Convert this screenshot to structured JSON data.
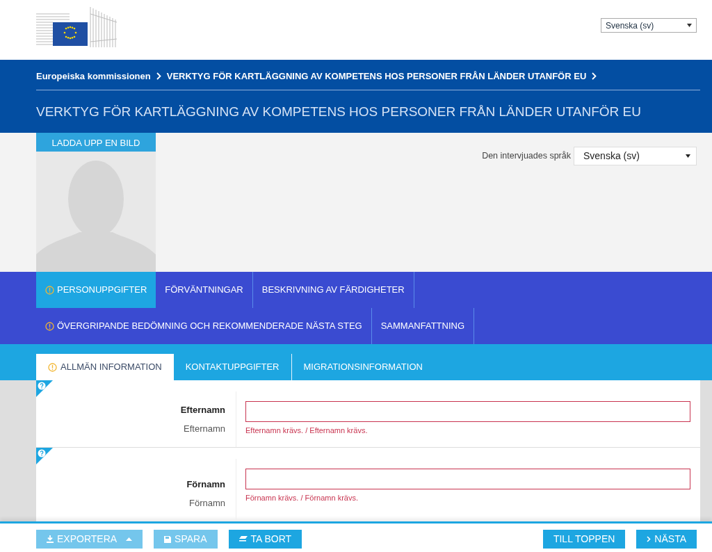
{
  "header": {
    "language_select": {
      "value": "Svenska (sv)"
    }
  },
  "breadcrumb": [
    {
      "label": "Europeiska kommissionen"
    },
    {
      "label": "VERKTYG FÖR KARTLÄGGNING AV KOMPETENS HOS PERSONER FRÅN LÄNDER UTANFÖR EU"
    }
  ],
  "page_title": "VERKTYG FÖR KARTLÄGGNING AV KOMPETENS HOS PERSONER FRÅN LÄNDER UTANFÖR EU",
  "profile": {
    "upload_button": "LADDA UPP EN BILD"
  },
  "interview_language": {
    "label": "Den intervjuades språk",
    "value": "Svenska (sv)"
  },
  "section_tab_rows": [
    {
      "tabs": [
        {
          "label": "PERSONUPPGIFTER",
          "selected": true,
          "warning": true
        },
        {
          "label": "FÖRVÄNTNINGAR",
          "selected": false,
          "warning": false
        },
        {
          "label": "BESKRIVNING AV FÄRDIGHETER",
          "selected": false,
          "warning": false
        }
      ]
    },
    {
      "tabs": [
        {
          "label": "ÖVERGRIPANDE BEDÖMNING OCH REKOMMENDERADE NÄSTA STEG",
          "selected": false,
          "warning": true
        },
        {
          "label": "SAMMANFATTNING",
          "selected": false,
          "warning": false
        }
      ]
    }
  ],
  "sub_tabs": [
    {
      "label": "ALLMÄN INFORMATION",
      "selected": true,
      "warning": true
    },
    {
      "label": "KONTAKTUPPGIFTER",
      "selected": false,
      "warning": false
    },
    {
      "label": "MIGRATIONSINFORMATION",
      "selected": false,
      "warning": false
    }
  ],
  "fields": [
    {
      "label": "Efternamn",
      "sublabel": "Efternamn",
      "error": "Efternamn krävs. / Efternamn krävs.",
      "invalid": true
    },
    {
      "label": "Förnamn",
      "sublabel": "Förnamn",
      "error": "Förnamn krävs. / Förnamn krävs.",
      "invalid": true
    }
  ],
  "footer": {
    "left": [
      {
        "label": "EXPORTERA",
        "kind": "export",
        "disabled": true
      },
      {
        "label": "SPARA",
        "kind": "save",
        "disabled": true
      },
      {
        "label": "TA BORT",
        "kind": "delete",
        "disabled": false
      }
    ],
    "right": [
      {
        "label": "TILL TOPPEN",
        "kind": "top",
        "disabled": false
      },
      {
        "label": "NÄSTA",
        "kind": "next",
        "disabled": false
      }
    ]
  }
}
